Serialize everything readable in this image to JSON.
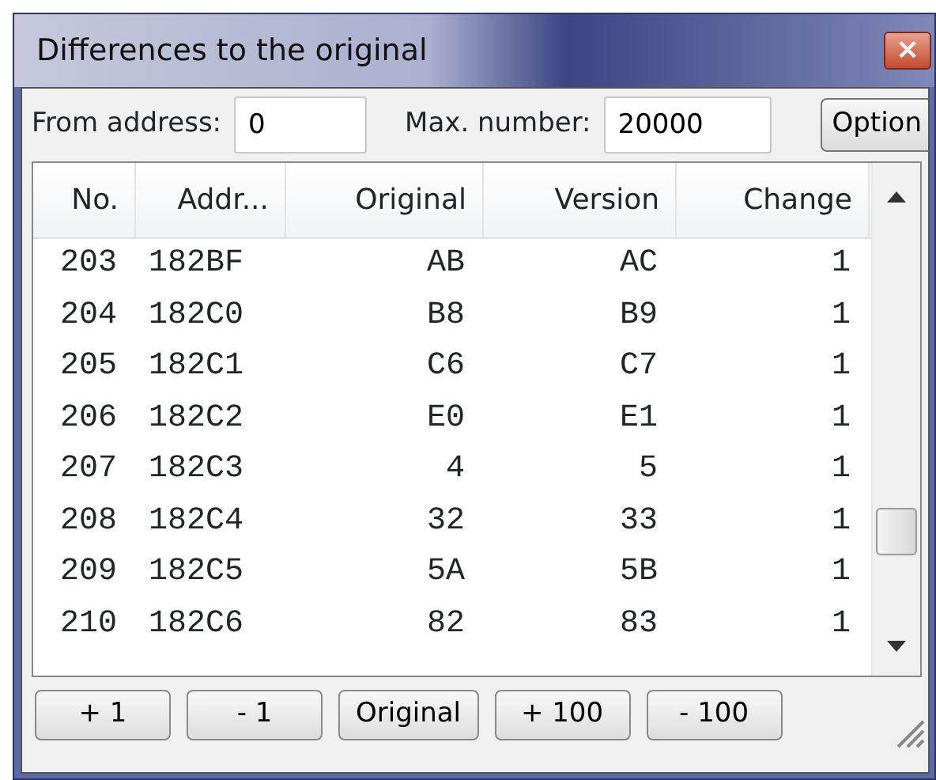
{
  "window": {
    "title": "Differences to the original",
    "close_glyph": "×"
  },
  "toolbar": {
    "from_label": "From address:",
    "from_value": "0",
    "max_label": "Max. number:",
    "max_value": "20000",
    "options_button": "Option"
  },
  "table": {
    "columns": [
      "No.",
      "Addr...",
      "Original",
      "Version",
      "Change"
    ],
    "rows": [
      [
        "203",
        "182BF",
        "AB",
        "AC",
        "1"
      ],
      [
        "204",
        "182C0",
        "B8",
        "B9",
        "1"
      ],
      [
        "205",
        "182C1",
        "C6",
        "C7",
        "1"
      ],
      [
        "206",
        "182C2",
        "E0",
        "E1",
        "1"
      ],
      [
        "207",
        "182C3",
        "4",
        "5",
        "1"
      ],
      [
        "208",
        "182C4",
        "32",
        "33",
        "1"
      ],
      [
        "209",
        "182C5",
        "5A",
        "5B",
        "1"
      ],
      [
        "210",
        "182C6",
        "82",
        "83",
        "1"
      ]
    ]
  },
  "buttons": [
    "+ 1",
    "- 1",
    "Original",
    "+ 100",
    "- 100"
  ]
}
